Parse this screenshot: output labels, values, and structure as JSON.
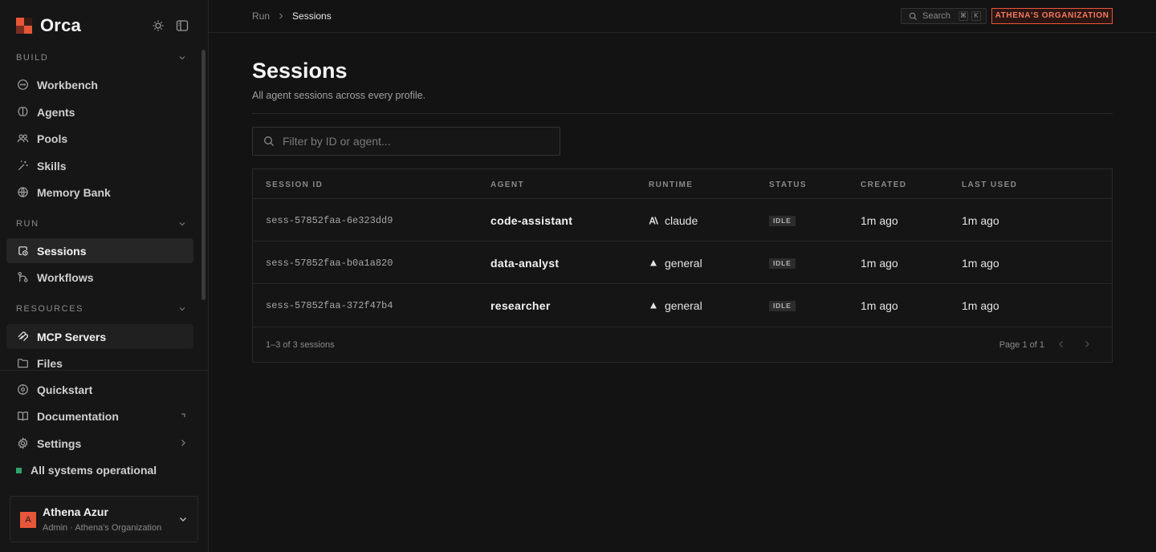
{
  "app": {
    "name": "Orca"
  },
  "sidebar": {
    "sections": [
      {
        "label": "BUILD",
        "items": [
          {
            "label": "Workbench",
            "icon": "chat-bubble-icon"
          },
          {
            "label": "Agents",
            "icon": "brain-icon"
          },
          {
            "label": "Pools",
            "icon": "users-icon"
          },
          {
            "label": "Skills",
            "icon": "wand-icon"
          },
          {
            "label": "Memory Bank",
            "icon": "database-icon"
          }
        ]
      },
      {
        "label": "RUN",
        "items": [
          {
            "label": "Sessions",
            "icon": "sessions-icon",
            "active": true
          },
          {
            "label": "Workflows",
            "icon": "workflow-icon"
          }
        ]
      },
      {
        "label": "RESOURCES",
        "items": [
          {
            "label": "MCP Servers",
            "icon": "mcp-icon",
            "hovered": true
          },
          {
            "label": "Files",
            "icon": "folder-icon"
          }
        ]
      }
    ],
    "footer_items": [
      {
        "label": "Quickstart",
        "icon": "compass-icon"
      },
      {
        "label": "Documentation",
        "icon": "book-icon"
      },
      {
        "label": "Settings",
        "icon": "gear-icon"
      }
    ],
    "system_status": "All systems operational",
    "status_color": "#2fa36b",
    "user": {
      "initial": "A",
      "name": "Athena Azur",
      "role": "Admin · Athena's Organization"
    }
  },
  "topbar": {
    "breadcrumb": [
      "Run",
      "Sessions"
    ],
    "search_label": "Search",
    "search_keys": [
      "⌘",
      "K"
    ],
    "org_badge": "ATHENA'S ORGANIZATION",
    "accent": "#e8563a"
  },
  "page": {
    "title": "Sessions",
    "subtitle": "All agent sessions across every profile.",
    "filter_placeholder": "Filter by ID or agent..."
  },
  "table": {
    "columns": [
      "SESSION ID",
      "AGENT",
      "RUNTIME",
      "STATUS",
      "CREATED",
      "LAST USED"
    ],
    "rows": [
      {
        "session_id": "sess-57852faa-6e323dd9",
        "agent": "code-assistant",
        "runtime": "claude",
        "runtime_icon": "anthropic-icon",
        "status": "IDLE",
        "created": "1m ago",
        "last_used": "1m ago"
      },
      {
        "session_id": "sess-57852faa-b0a1a820",
        "agent": "data-analyst",
        "runtime": "general",
        "runtime_icon": "triangle-icon",
        "status": "IDLE",
        "created": "1m ago",
        "last_used": "1m ago"
      },
      {
        "session_id": "sess-57852faa-372f47b4",
        "agent": "researcher",
        "runtime": "general",
        "runtime_icon": "triangle-icon",
        "status": "IDLE",
        "created": "1m ago",
        "last_used": "1m ago"
      }
    ],
    "count_text": "1–3 of 3 sessions",
    "page_text": "Page 1 of 1"
  }
}
